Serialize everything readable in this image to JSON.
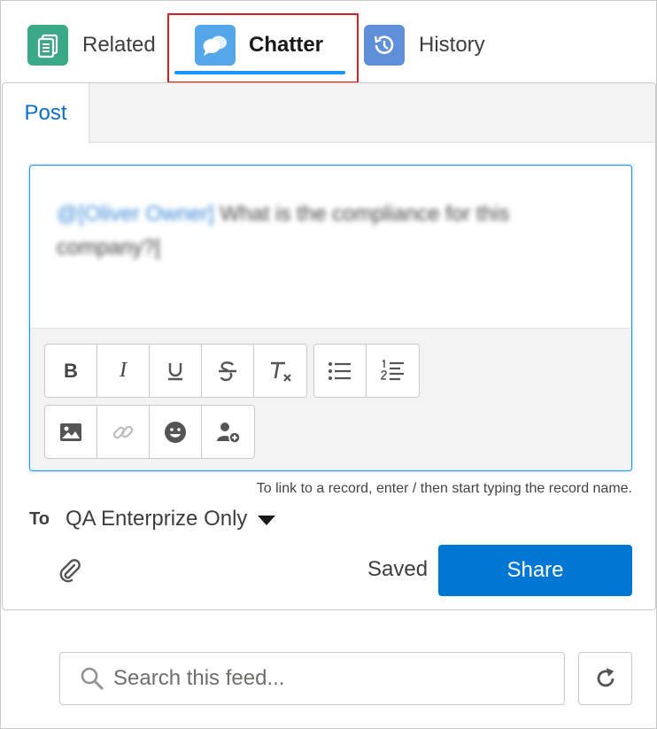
{
  "tabs": [
    {
      "label": "Related",
      "icon": "related-list-icon",
      "active": false
    },
    {
      "label": "Chatter",
      "icon": "chatter-icon",
      "active": true
    },
    {
      "label": "History",
      "icon": "history-icon",
      "active": false
    }
  ],
  "publisher": {
    "subtab": "Post",
    "mention": "@[Oliver Owner]",
    "message": " What is the compliance for this company?",
    "toolbar": {
      "bold": "B",
      "italic": "I",
      "underline": "U"
    },
    "hint": "To link to a record, enter / then start typing the record name.",
    "to_label": "To",
    "to_value": "QA Enterprize Only",
    "saved_label": "Saved",
    "share_label": "Share"
  },
  "search": {
    "placeholder": "Search this feed..."
  },
  "colors": {
    "accent": "#0176d3",
    "tab_underline": "#1b96ff",
    "highlight": "#d9211f",
    "related_icon_bg": "#3ba886",
    "chatter_icon_bg": "#54a7e8",
    "history_icon_bg": "#5f8fd9"
  }
}
